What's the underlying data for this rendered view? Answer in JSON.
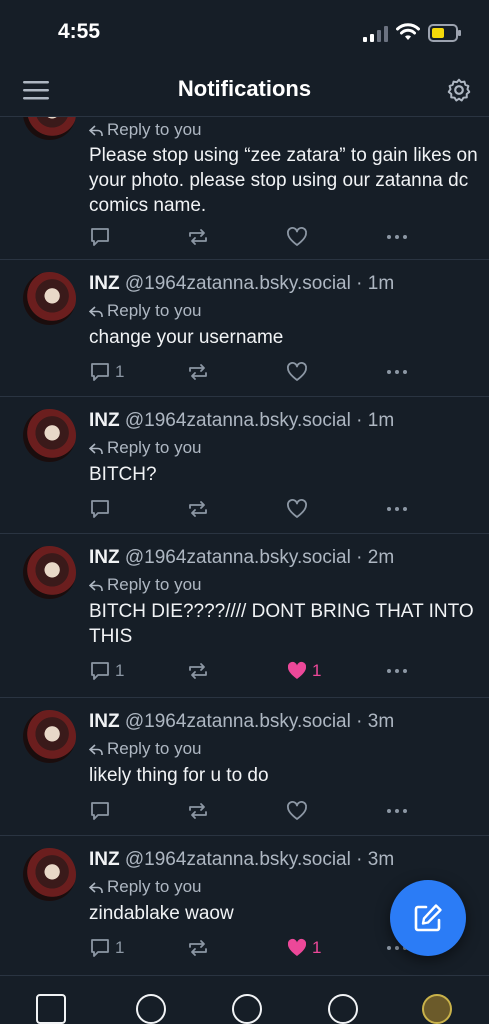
{
  "status_bar": {
    "time": "4:55"
  },
  "header": {
    "title": "Notifications"
  },
  "notifications": [
    {
      "author_name": "",
      "author_handle": "",
      "time": "",
      "reply_label": "Reply to you",
      "text": "Please stop using “zee zatara” to gain likes on your photo. please stop using our zatanna dc comics name.",
      "reply_count": "",
      "like_count": "",
      "liked": false
    },
    {
      "author_name": "INZ",
      "author_handle": "@1964zatanna.bsky.social",
      "time": "· 1m",
      "reply_label": "Reply to you",
      "text": "change your username",
      "reply_count": "1",
      "like_count": "",
      "liked": false
    },
    {
      "author_name": "INZ",
      "author_handle": "@1964zatanna.bsky.social",
      "time": "· 1m",
      "reply_label": "Reply to you",
      "text": "BITCH?",
      "reply_count": "",
      "like_count": "",
      "liked": false
    },
    {
      "author_name": "INZ",
      "author_handle": "@1964zatanna.bsky.social",
      "time": "· 2m",
      "reply_label": "Reply to you",
      "text": "BITCH DIE????//// DONT BRING THAT INTO THIS",
      "reply_count": "1",
      "like_count": "1",
      "liked": true
    },
    {
      "author_name": "INZ",
      "author_handle": "@1964zatanna.bsky.social",
      "time": "· 3m",
      "reply_label": "Reply to you",
      "text": "likely thing for u to do",
      "reply_count": "",
      "like_count": "",
      "liked": false
    },
    {
      "author_name": "INZ",
      "author_handle": "@1964zatanna.bsky.social",
      "time": "· 3m",
      "reply_label": "Reply to you",
      "text": "zindablake waow",
      "reply_count": "1",
      "like_count": "1",
      "liked": true
    }
  ],
  "icons": {
    "reply": "reply-arrow-icon",
    "comment": "comment-icon",
    "repost": "repost-icon",
    "like": "heart-icon",
    "more": "more-dots-icon",
    "compose": "compose-icon",
    "menu": "hamburger-menu-icon",
    "settings": "gear-icon"
  },
  "colors": {
    "accent": "#2b7cf6",
    "like": "#ec4899",
    "background": "#161e27"
  }
}
